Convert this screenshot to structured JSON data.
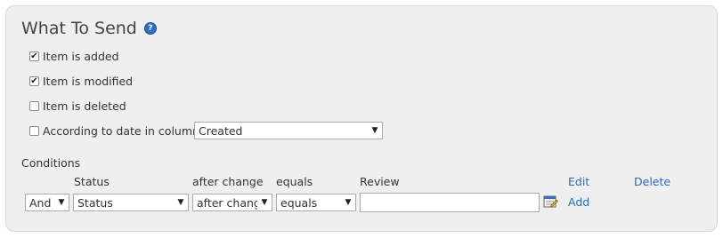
{
  "section": {
    "title": "What To Send",
    "help_icon_glyph": "?"
  },
  "checkboxes": [
    {
      "label": "Item is added",
      "checked": true
    },
    {
      "label": "Item is modified",
      "checked": true
    },
    {
      "label": "Item is deleted",
      "checked": false
    },
    {
      "label": "According to date in column",
      "checked": false
    }
  ],
  "date_column_select": {
    "value": "Created"
  },
  "conditions": {
    "heading": "Conditions",
    "headers": {
      "field": "Status",
      "when": "after change",
      "operator": "equals",
      "value": "Review",
      "edit": "Edit",
      "delete": "Delete"
    },
    "row": {
      "join": "And",
      "field": "Status",
      "when": "after chang",
      "operator": "equals",
      "value": "",
      "add": "Add"
    }
  },
  "icons": {
    "help": "help-icon",
    "value_picker": "lookup-picker-icon",
    "dropdown": "chevron-down-icon"
  },
  "colors": {
    "panel_background": "#efefef",
    "link": "#2a6db8",
    "help_icon": "#2f6fc2"
  }
}
